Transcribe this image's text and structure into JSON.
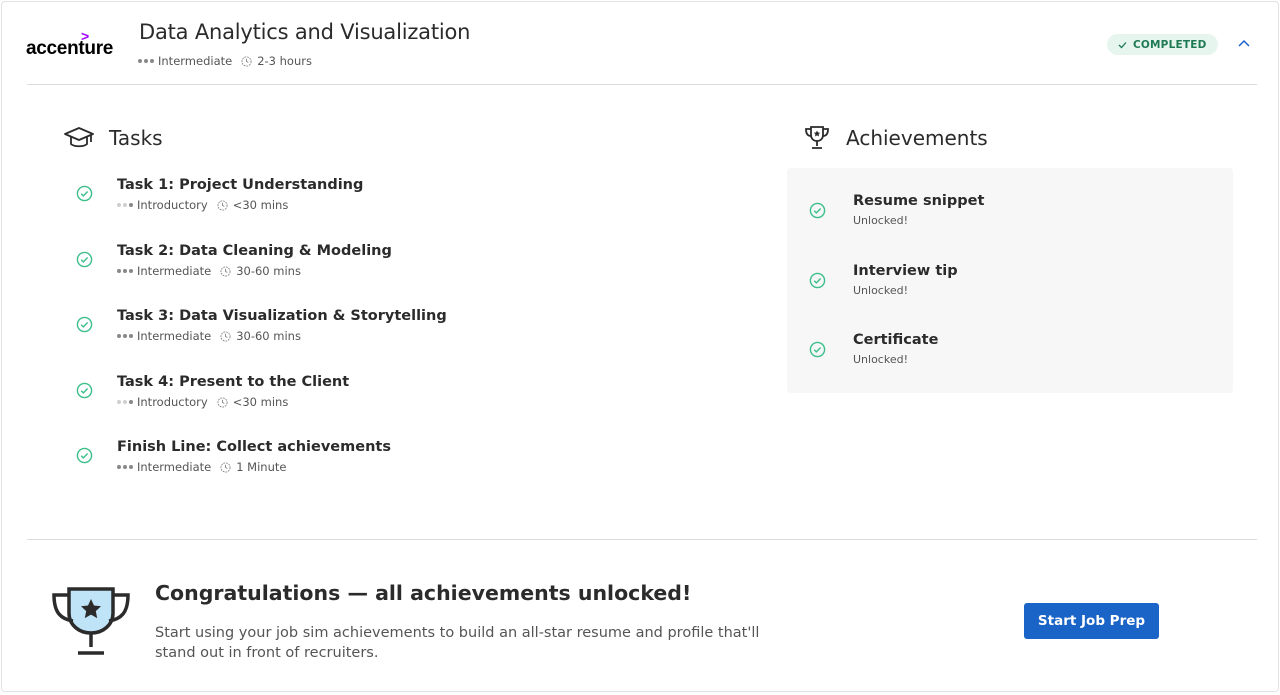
{
  "header": {
    "company_logo_text": "accenture",
    "title": "Data Analytics and Visualization",
    "level": "Intermediate",
    "duration": "2-3 hours",
    "status_badge": "COMPLETED"
  },
  "tasks_section": {
    "heading": "Tasks",
    "tasks": [
      {
        "name": "Task 1: Project Understanding",
        "level": "Introductory",
        "duration": "<30 mins"
      },
      {
        "name": "Task 2: Data Cleaning & Modeling",
        "level": "Intermediate",
        "duration": "30-60 mins"
      },
      {
        "name": "Task 3: Data Visualization & Storytelling",
        "level": "Intermediate",
        "duration": "30-60 mins"
      },
      {
        "name": "Task 4: Present to the Client",
        "level": "Introductory",
        "duration": "<30 mins"
      },
      {
        "name": "Finish Line: Collect achievements",
        "level": "Intermediate",
        "duration": "1 Minute"
      }
    ]
  },
  "achievements_section": {
    "heading": "Achievements",
    "items": [
      {
        "name": "Resume snippet",
        "status": "Unlocked!"
      },
      {
        "name": "Interview tip",
        "status": "Unlocked!"
      },
      {
        "name": "Certificate",
        "status": "Unlocked!"
      }
    ]
  },
  "congrats": {
    "title": "Congratulations — all achievements unlocked!",
    "body": "Start using your job sim achievements to build an all-star resume and profile that'll stand out in front of recruiters.",
    "button_label": "Start Job Prep"
  },
  "colors": {
    "accent_purple": "#a100ff",
    "check_green": "#3cbf8a",
    "badge_bg": "#e6f5ee",
    "badge_text": "#1f7a53",
    "button_blue": "#1a63c7"
  }
}
